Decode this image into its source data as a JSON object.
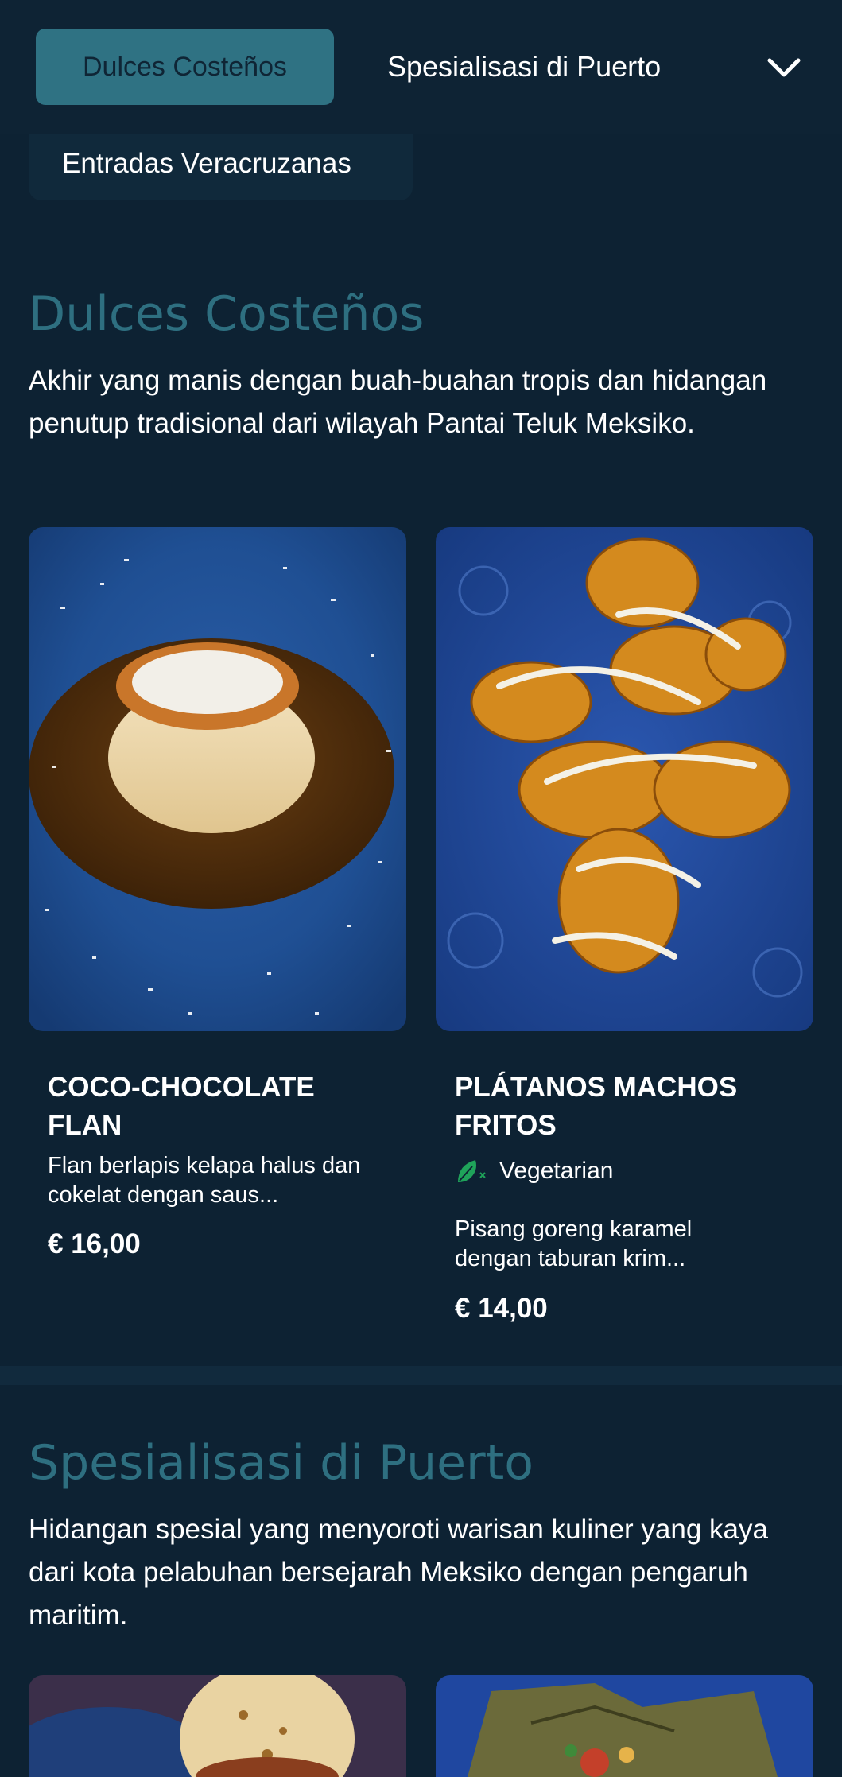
{
  "nav": {
    "active_tab": "Dulces Costeños",
    "tab_2": "Spesialisasi di Puerto",
    "tab_3": "Entradas Veracruzanas"
  },
  "sections": [
    {
      "title": "Dulces Costeños",
      "description": "Akhir yang manis dengan buah-buahan tropis dan hidangan penutup tradisional dari wilayah Pantai Teluk Meksiko.",
      "items": [
        {
          "name": "COCO-CHOCOLATE FLAN",
          "description": "Flan berlapis kelapa halus dan cokelat dengan saus...",
          "price": "€ 16,00"
        },
        {
          "name": "PLÁTANOS MACHOS FRITOS",
          "tag": "Vegetarian",
          "description": "Pisang goreng karamel dengan taburan krim...",
          "price": "€ 14,00"
        }
      ]
    },
    {
      "title": "Spesialisasi di Puerto",
      "description": "Hidangan spesial yang menyoroti warisan kuliner yang kaya dari kota pelabuhan bersejarah Meksiko dengan pengaruh maritim."
    }
  ],
  "colors": {
    "background": "#0d2233",
    "accent": "#2f7283",
    "section_title": "#2e6f80",
    "veg_icon": "#1fa35a"
  },
  "icons": [
    "chevron-down-icon",
    "vegetarian-leaf-icon"
  ]
}
